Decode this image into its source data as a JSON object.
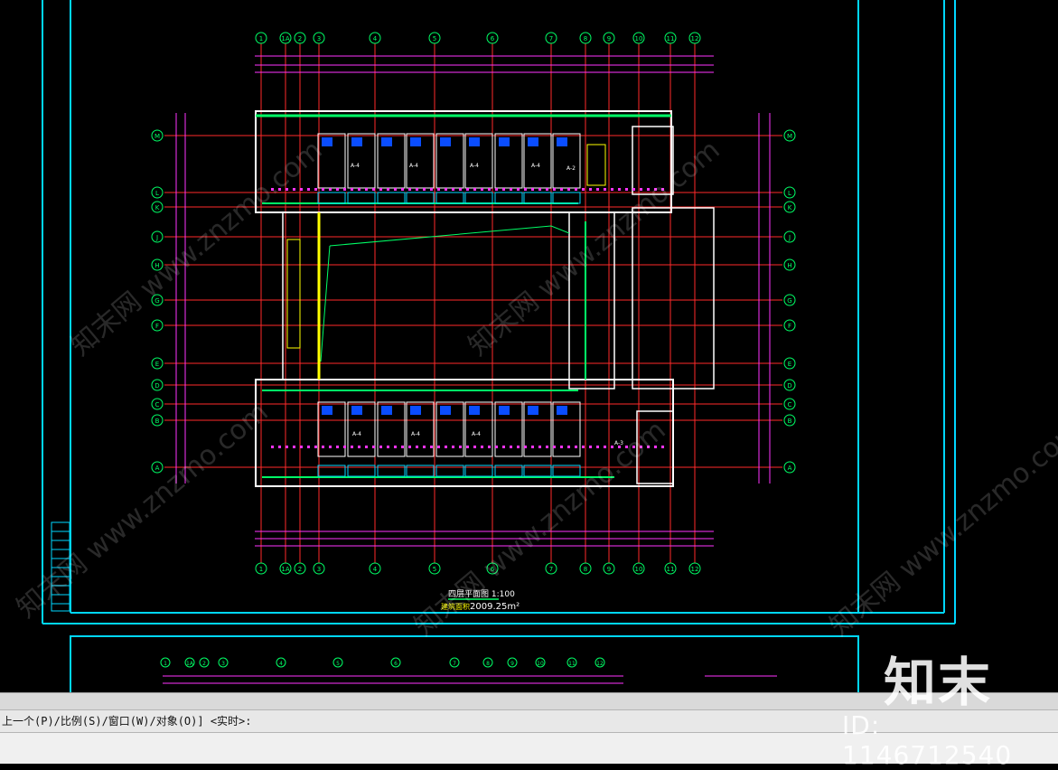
{
  "drawing": {
    "plan_title": "四层平面图 1:100",
    "area_label": "建筑面积",
    "area_value": "2009.25m²",
    "grid_bubbles": [
      "1",
      "1A",
      "2",
      "3",
      "4",
      "5",
      "6",
      "7",
      "8",
      "9",
      "10",
      "11",
      "12"
    ],
    "row_bubbles": [
      "M",
      "L",
      "K",
      "J",
      "H",
      "G",
      "F",
      "E",
      "D",
      "C",
      "B",
      "A"
    ],
    "room_labels": [
      "A-4",
      "A-4",
      "A-4",
      "A-4",
      "A-2",
      "A-4",
      "A-4",
      "A-4",
      "A-3"
    ],
    "colors": {
      "background": "#000000",
      "frame": "#00d7ff",
      "axis": "#ff2a2a",
      "dimension": "#ff33ff",
      "wall": "#ffffff",
      "accent_green": "#00ff66",
      "stair": "#ffff00"
    }
  },
  "command_line": {
    "prompt": "上一个(P)/比例(S)/窗口(W)/对象(O)] <实时>:"
  },
  "watermarks": {
    "logo": "知末",
    "id": "ID: 1146712540",
    "diagonal": "知末网 www.znzmo.com"
  }
}
